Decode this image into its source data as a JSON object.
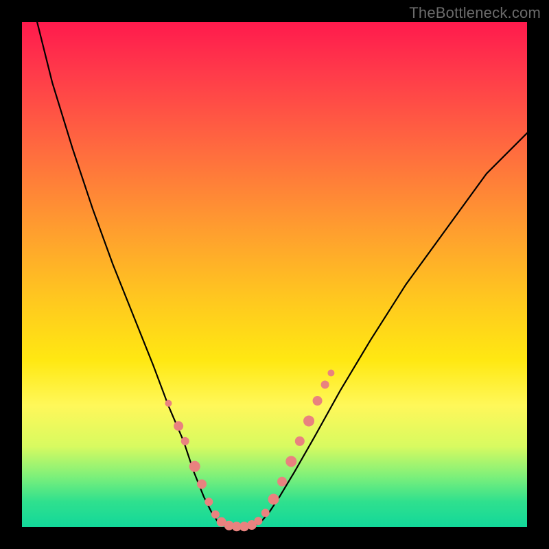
{
  "watermark": "TheBottleneck.com",
  "chart_data": {
    "type": "line",
    "title": "",
    "xlabel": "",
    "ylabel": "",
    "xlim": [
      0,
      100
    ],
    "ylim": [
      0,
      100
    ],
    "grid": false,
    "legend": false,
    "series": [
      {
        "name": "curve-left",
        "x": [
          3,
          6,
          10,
          14,
          18,
          22,
          26,
          29,
          32,
          34,
          36,
          37.5,
          38.8
        ],
        "values": [
          100,
          88,
          75,
          63,
          52,
          42,
          32,
          24,
          17,
          11,
          6,
          3,
          1
        ]
      },
      {
        "name": "curve-bottom",
        "x": [
          38.8,
          40,
          41.5,
          43,
          44.5,
          46,
          47.3
        ],
        "values": [
          1,
          0.3,
          0,
          0,
          0,
          0.3,
          1
        ]
      },
      {
        "name": "curve-right",
        "x": [
          47.3,
          49,
          51,
          54,
          58,
          63,
          69,
          76,
          84,
          92,
          100
        ],
        "values": [
          1,
          3,
          6,
          11,
          18,
          27,
          37,
          48,
          59,
          70,
          78
        ]
      }
    ],
    "markers": {
      "name": "highlight-dots",
      "color": "#e9827f",
      "points": [
        {
          "x": 29.0,
          "y": 24.5,
          "r": 5
        },
        {
          "x": 31.0,
          "y": 20.0,
          "r": 7
        },
        {
          "x": 32.3,
          "y": 17.0,
          "r": 6
        },
        {
          "x": 34.2,
          "y": 12.0,
          "r": 8
        },
        {
          "x": 35.6,
          "y": 8.5,
          "r": 7
        },
        {
          "x": 37.0,
          "y": 5.0,
          "r": 6
        },
        {
          "x": 38.3,
          "y": 2.5,
          "r": 6
        },
        {
          "x": 39.5,
          "y": 1.0,
          "r": 7
        },
        {
          "x": 41.0,
          "y": 0.3,
          "r": 7
        },
        {
          "x": 42.5,
          "y": 0.1,
          "r": 7
        },
        {
          "x": 44.0,
          "y": 0.1,
          "r": 7
        },
        {
          "x": 45.5,
          "y": 0.4,
          "r": 7
        },
        {
          "x": 46.8,
          "y": 1.2,
          "r": 6
        },
        {
          "x": 48.2,
          "y": 2.8,
          "r": 6
        },
        {
          "x": 49.8,
          "y": 5.5,
          "r": 8
        },
        {
          "x": 51.5,
          "y": 9.0,
          "r": 7
        },
        {
          "x": 53.3,
          "y": 13.0,
          "r": 8
        },
        {
          "x": 55.0,
          "y": 17.0,
          "r": 7
        },
        {
          "x": 56.8,
          "y": 21.0,
          "r": 8
        },
        {
          "x": 58.5,
          "y": 25.0,
          "r": 7
        },
        {
          "x": 60.0,
          "y": 28.2,
          "r": 6
        },
        {
          "x": 61.2,
          "y": 30.5,
          "r": 5
        }
      ]
    }
  }
}
